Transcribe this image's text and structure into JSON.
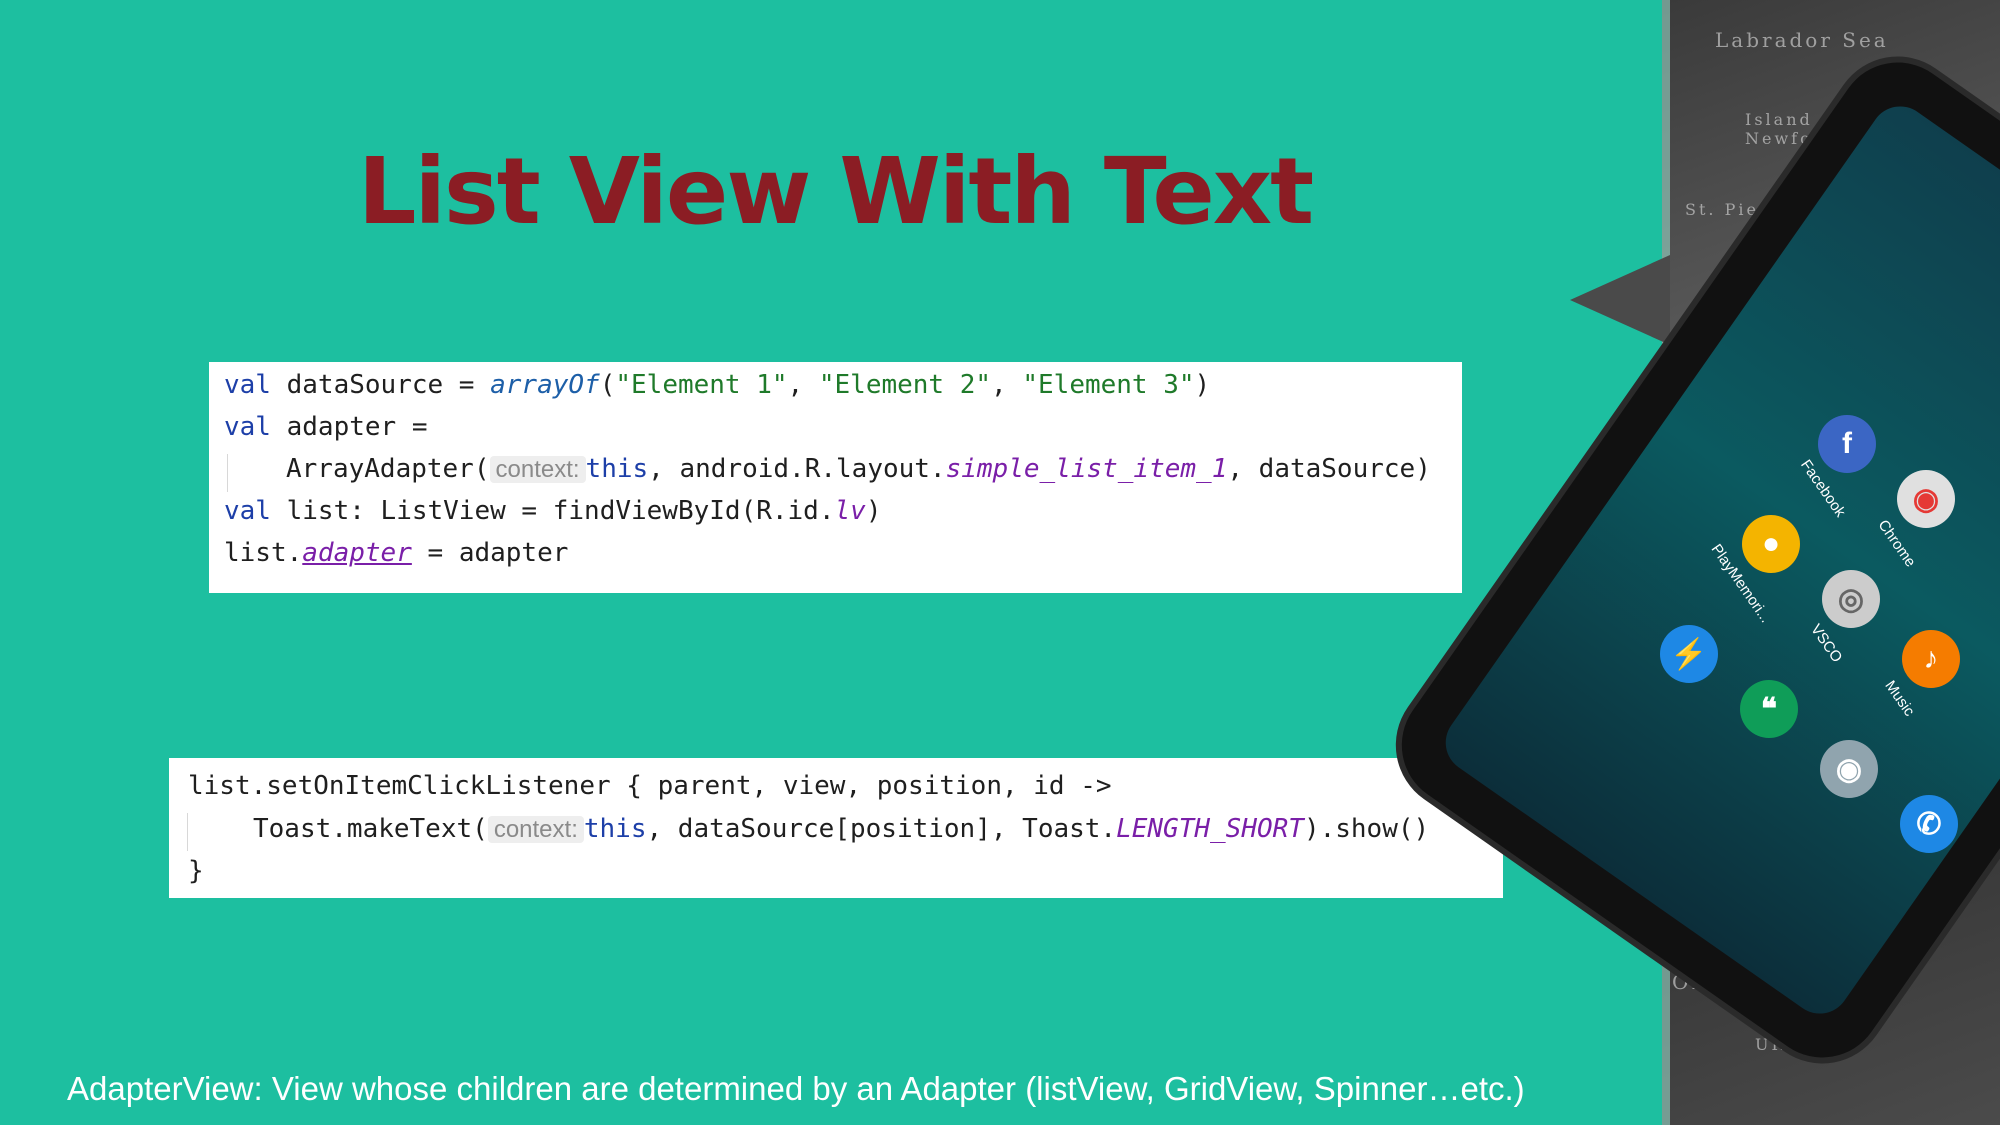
{
  "title": "List View With Text",
  "code_block_1": {
    "line1": {
      "kw": "val",
      "a": " dataSource = ",
      "fn": "arrayOf",
      "b": "(",
      "s1": "\"Element 1\"",
      "c1": ", ",
      "s2": "\"Element 2\"",
      "c2": ", ",
      "s3": "\"Element 3\"",
      "d": ")"
    },
    "line2": {
      "kw": "val",
      "a": " adapter ="
    },
    "line3": {
      "a": "ArrayAdapter(",
      "hint": "context:",
      "kw": "this",
      "b": ", android.R.layout.",
      "ital": "simple_list_item_1",
      "c": ", dataSource)"
    },
    "line4": {
      "kw": "val",
      "a": " list: ListView = findViewById(R.id.",
      "ital": "lv",
      "b": ")"
    },
    "line5": {
      "a": "list.",
      "prop": "adapter",
      "b": " = adapter"
    }
  },
  "code_block_2": {
    "line1": {
      "a": "list.setOnItemClickListener { parent, view, position, id ->"
    },
    "line2": {
      "a": "Toast.makeText(",
      "hint": "context:",
      "kw": "this",
      "b": ", dataSource[position], Toast.",
      "ital": "LENGTH_SHORT",
      "c": ").show()"
    },
    "line3": {
      "a": "}"
    }
  },
  "caption": "AdapterView: View whose children are determined by an Adapter (listView, GridView, Spinner…etc.)",
  "decor": {
    "map_labels": [
      "Labrador Sea",
      "Island of Newfoundland",
      "St. Pierre",
      "OLIVIA",
      "URUGUAY"
    ],
    "apps": [
      {
        "name": "Facebook",
        "icon": "facebook-icon",
        "color": "#3b66c4",
        "glyph": "f"
      },
      {
        "name": "Chrome",
        "icon": "chrome-icon",
        "color": "#e0e0e0",
        "glyph": "◉"
      },
      {
        "name": "PlayMemori...",
        "icon": "playmemories-icon",
        "color": "#f4b400",
        "glyph": "●"
      },
      {
        "name": "VSCO",
        "icon": "vsco-icon",
        "color": "#cccccc",
        "glyph": "◎"
      },
      {
        "name": "Music",
        "icon": "music-icon",
        "color": "#f57c00",
        "glyph": "♪"
      },
      {
        "name": "Messenger",
        "icon": "messenger-icon",
        "color": "#1e88e5",
        "glyph": "⚡"
      },
      {
        "name": "Hangouts",
        "icon": "hangouts-icon",
        "color": "#0f9d58",
        "glyph": "❝"
      },
      {
        "name": "Camera",
        "icon": "camera-icon",
        "color": "#90a4ae",
        "glyph": "◉"
      },
      {
        "name": "Phone",
        "icon": "phone-icon",
        "color": "#1e88e5",
        "glyph": "✆"
      }
    ]
  }
}
